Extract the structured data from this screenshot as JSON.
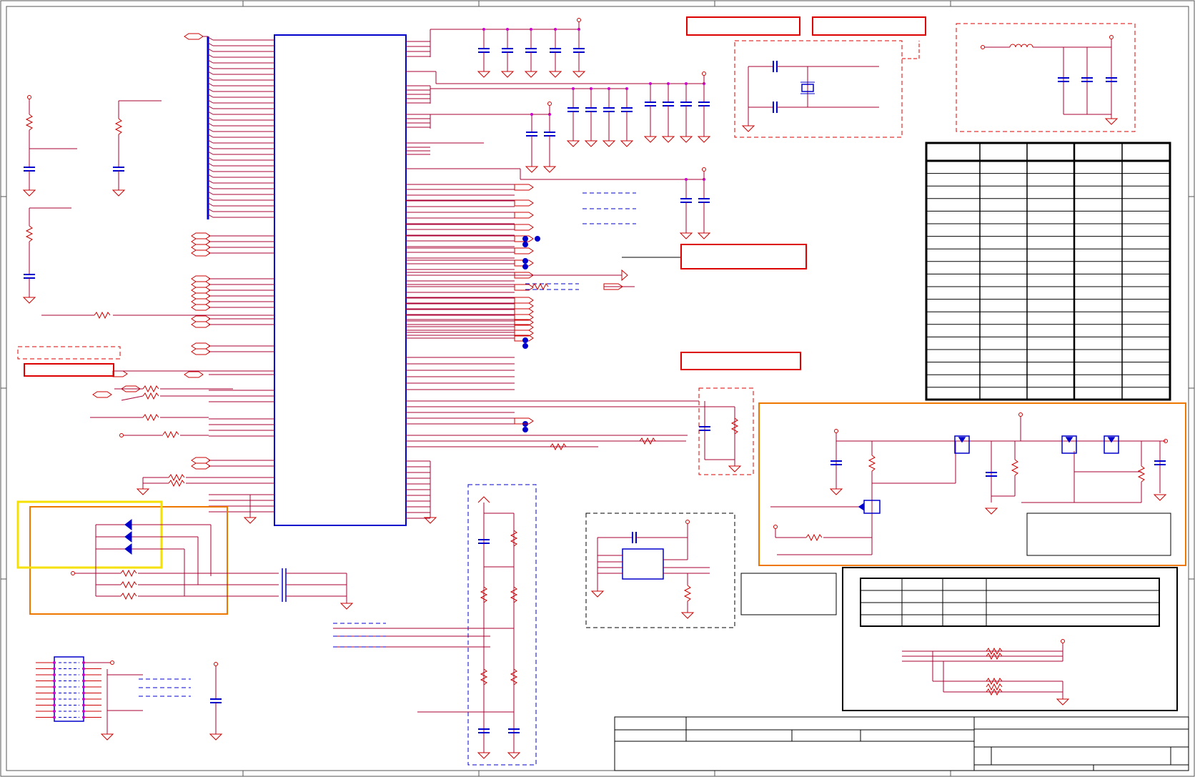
{
  "sheet": {
    "title_block": {
      "company": "",
      "title": "",
      "size": "",
      "document_number": "",
      "revision": "",
      "date": "",
      "sheet_info": ""
    },
    "notes": {
      "red_boxes": [
        "",
        "",
        "",
        "",
        ""
      ],
      "annotation_box_1": "",
      "annotation_box_2": ""
    },
    "tables": {
      "main_table": {
        "columns": 5,
        "rows": 20,
        "cells": []
      },
      "sub_table": {
        "columns": 4,
        "rows": 3,
        "cells": []
      }
    },
    "regions": {
      "highlight_yellow": "",
      "highlight_orange_left": "",
      "power_switch_block": ""
    }
  }
}
